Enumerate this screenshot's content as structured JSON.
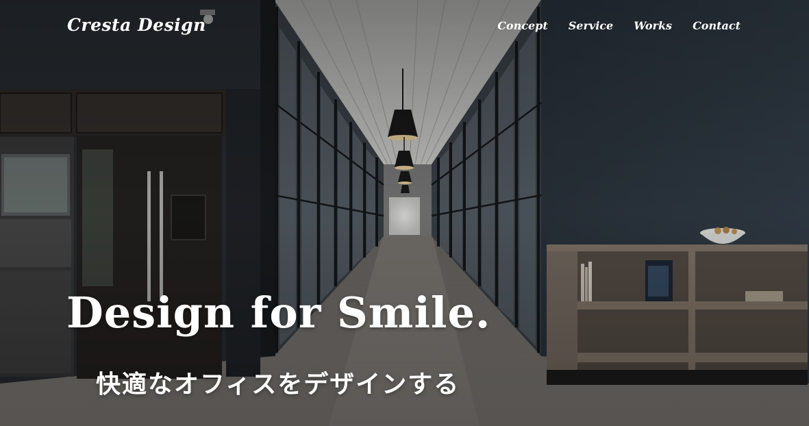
{
  "header": {
    "logo": "Cresta Design",
    "nav": [
      {
        "label": "Concept"
      },
      {
        "label": "Service"
      },
      {
        "label": "Works"
      },
      {
        "label": "Contact"
      }
    ]
  },
  "hero": {
    "headline": "Design for Smile.",
    "subline": "快適なオフィスをデザインする",
    "image_subject": "office-corridor-photo"
  },
  "colors": {
    "text": "#ffffff",
    "wall": "#2f3a44",
    "floor": "#8a8580"
  }
}
